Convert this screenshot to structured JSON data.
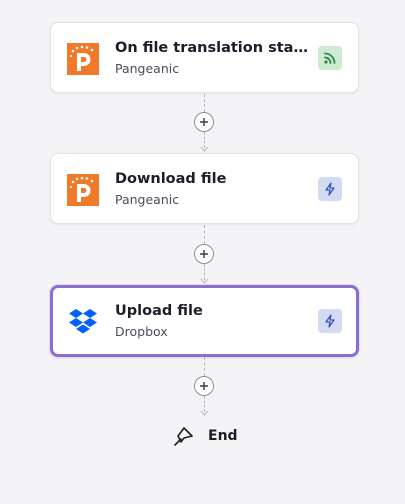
{
  "steps": [
    {
      "title": "On file translation statu...",
      "app": "Pangeanic",
      "type": "trigger",
      "badge_icon": "rss-icon",
      "app_icon": "pangeanic-logo-icon"
    },
    {
      "title": "Download file",
      "app": "Pangeanic",
      "type": "action",
      "badge_icon": "lightning-icon",
      "app_icon": "pangeanic-logo-icon"
    },
    {
      "title": "Upload file",
      "app": "Dropbox",
      "type": "action",
      "badge_icon": "lightning-icon",
      "app_icon": "dropbox-logo-icon",
      "selected": true
    }
  ],
  "end": {
    "label": "End",
    "icon": "flag-icon"
  },
  "colors": {
    "background": "#f4f4f6",
    "pangeanic_orange": "#ee7a2a",
    "dropbox_blue": "#0061fe",
    "selected_border": "#8a6fd1",
    "trigger_badge_bg": "#cfead3",
    "trigger_badge_fg": "#2e8b47",
    "action_badge_bg": "#d3dbf2",
    "action_badge_fg": "#2f4fb8"
  }
}
